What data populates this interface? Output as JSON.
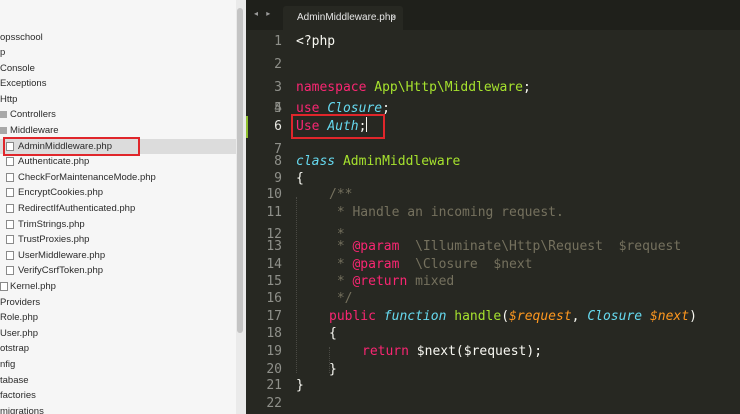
{
  "sidebar": {
    "items": [
      {
        "label": "opsschool",
        "icon": "none"
      },
      {
        "label": "p",
        "icon": "none"
      },
      {
        "label": "Console",
        "icon": "none"
      },
      {
        "label": "Exceptions",
        "icon": "none"
      },
      {
        "label": "Http",
        "icon": "none"
      },
      {
        "label": "Controllers",
        "icon": "folder-icon"
      },
      {
        "label": "Middleware",
        "icon": "folder-icon"
      },
      {
        "label": "AdminMiddleware.php",
        "icon": "file-icon"
      },
      {
        "label": "Authenticate.php",
        "icon": "file-icon"
      },
      {
        "label": "CheckForMaintenanceMode.php",
        "icon": "file-icon"
      },
      {
        "label": "EncryptCookies.php",
        "icon": "file-icon"
      },
      {
        "label": "RedirectIfAuthenticated.php",
        "icon": "file-icon"
      },
      {
        "label": "TrimStrings.php",
        "icon": "file-icon"
      },
      {
        "label": "TrustProxies.php",
        "icon": "file-icon"
      },
      {
        "label": "UserMiddleware.php",
        "icon": "file-icon"
      },
      {
        "label": "VerifyCsrfToken.php",
        "icon": "file-icon"
      },
      {
        "label": "Kernel.php",
        "icon": "file-icon"
      },
      {
        "label": "Providers",
        "icon": "none"
      },
      {
        "label": "Role.php",
        "icon": "none"
      },
      {
        "label": "User.php",
        "icon": "none"
      },
      {
        "label": "otstrap",
        "icon": "none"
      },
      {
        "label": "nfig",
        "icon": "none"
      },
      {
        "label": "tabase",
        "icon": "none"
      },
      {
        "label": "factories",
        "icon": "none"
      },
      {
        "label": "migrations",
        "icon": "none"
      }
    ]
  },
  "editor": {
    "tab_nav": "◂ ▸",
    "tab_label": "AdminMiddleware.php",
    "tab_close": "×",
    "line_numbers": [
      "1",
      "2",
      "3",
      "4",
      "5",
      "6",
      "7",
      "8",
      "9",
      "10",
      "11",
      "12",
      "13",
      "14",
      "15",
      "16",
      "17",
      "18",
      "19",
      "20",
      "21",
      "22"
    ],
    "code": {
      "l1": "<?php",
      "l3_kw": "namespace",
      "l3_ns": "App\\Http\\Middleware",
      "l3_end": ";",
      "l5_kw": "use",
      "l5_cls": "Closure",
      "l5_end": ";",
      "l6_kw": "Use",
      "l6_cls": "Auth",
      "l6_end": ";",
      "l8_kw": "class",
      "l8_name": "AdminMiddleware",
      "l9": "{",
      "l10": "/**",
      "l11": " * Handle an incoming request.",
      "l12": " *",
      "l13_a": " * ",
      "l13_tag": "@param",
      "l13_b": "  \\Illuminate\\Http\\Request  $request",
      "l14_a": " * ",
      "l14_tag": "@param",
      "l14_b": "  \\Closure  $next",
      "l15_a": " * ",
      "l15_tag": "@return",
      "l15_b": " mixed",
      "l16": " */",
      "l17_pub": "public",
      "l17_fn": "function",
      "l17_name": "handle",
      "l17_open": "(",
      "l17_p1": "$request",
      "l17_comma": ", ",
      "l17_type": "Closure",
      "l17_p2": "$next",
      "l17_close": ")",
      "l18": "{",
      "l19_kw": "return",
      "l19_rest": " $next($request);",
      "l20": "}",
      "l21": "}"
    }
  },
  "colors": {
    "editor_bg": "#272822",
    "keyword": "#f92672",
    "type_italic": "#66d9ef",
    "param": "#fd971f",
    "comment": "#75715e",
    "highlight_box": "#e0262b"
  }
}
